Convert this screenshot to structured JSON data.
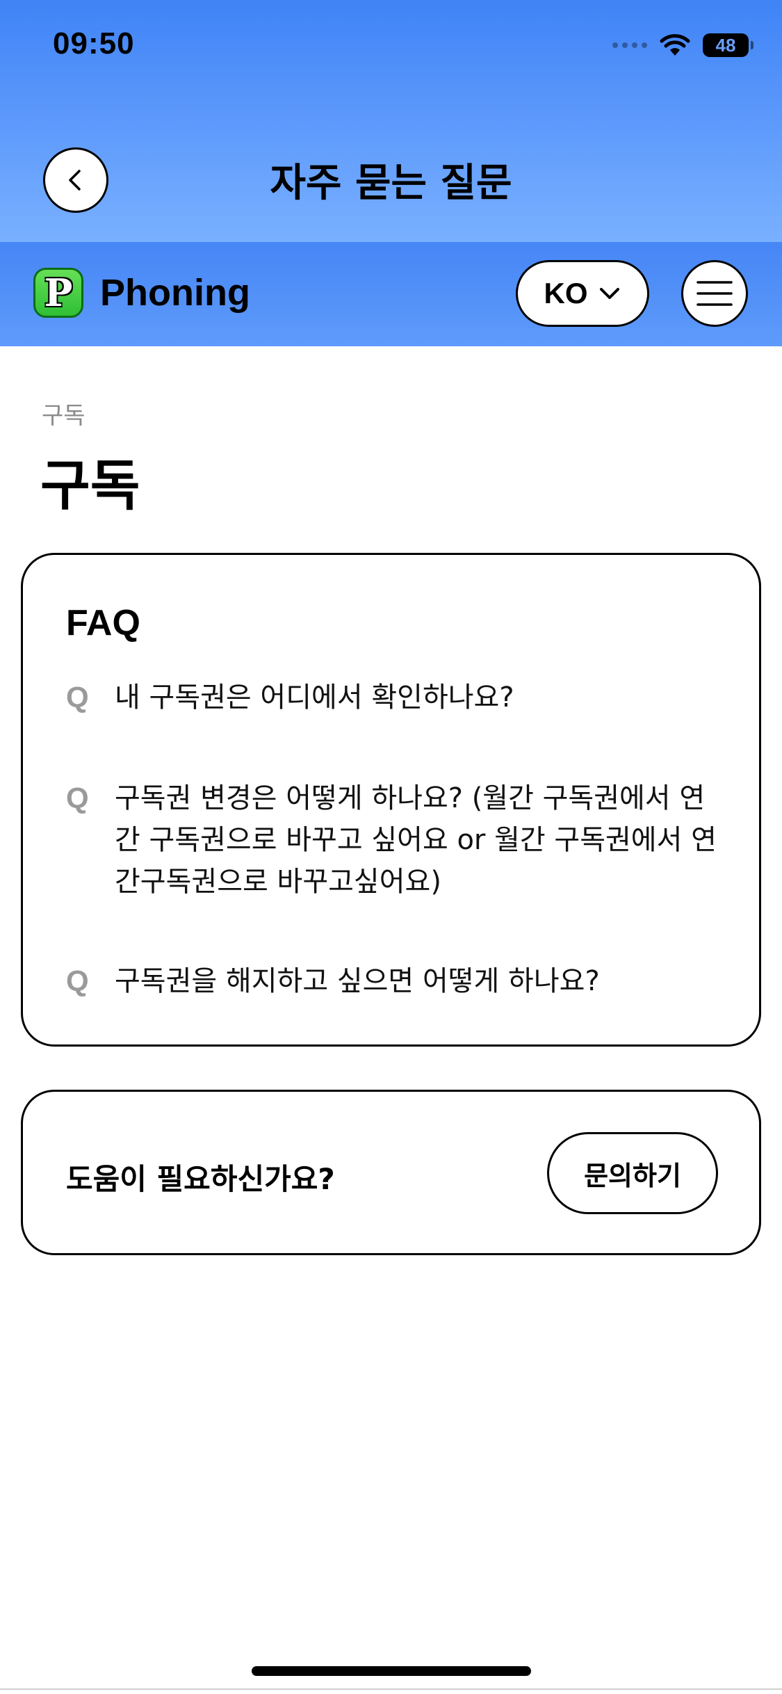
{
  "status_bar": {
    "time": "09:50",
    "battery": "48"
  },
  "header": {
    "title": "자주 묻는 질문",
    "back_icon": "chevron-left-icon"
  },
  "brand": {
    "logo_letter": "P",
    "name": "Phoning",
    "language": "KO",
    "menu_icon": "hamburger-menu-icon"
  },
  "content": {
    "breadcrumb": "구독",
    "title": "구독"
  },
  "faq": {
    "heading": "FAQ",
    "q_marker": "Q",
    "items": [
      {
        "text": "내 구독권은 어디에서 확인하나요?"
      },
      {
        "text": "구독권 변경은 어떻게 하나요? (월간 구독권에서 연간 구독권으로 바꾸고 싶어요 or 월간 구독권에서 연간구독권으로 바꾸고싶어요)"
      },
      {
        "text": "구독권을 해지하고 싶으면 어떻게 하나요?"
      }
    ]
  },
  "help": {
    "text": "도움이 필요하신가요?",
    "button_label": "문의하기"
  },
  "colors": {
    "header_blue": "#3f83f6",
    "brand_green": "#2fbf35",
    "q_gray": "#9a9a9a"
  }
}
